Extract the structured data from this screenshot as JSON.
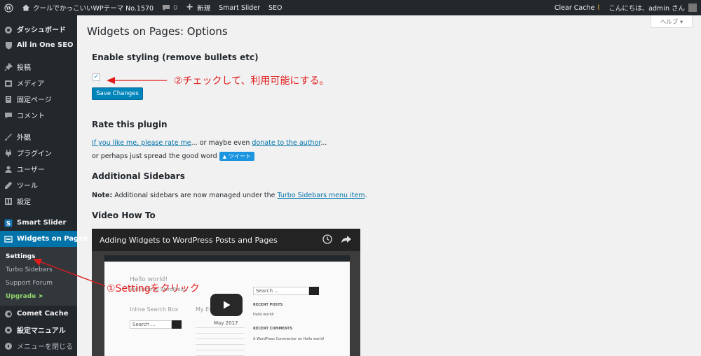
{
  "adminbar": {
    "site_name": "クールでかっこいいWPテーマ No.1570",
    "comments_count": "0",
    "new_label": "新規",
    "smart_slider": "Smart Slider",
    "seo": "SEO",
    "clear_cache": "Clear Cache",
    "greeting": "こんにちは、admin さん"
  },
  "sidebar": {
    "items": [
      {
        "label": "ダッシュボード",
        "icon": "dashboard-icon"
      },
      {
        "label": "All in One SEO",
        "icon": "shield-icon"
      },
      {
        "label": "投稿",
        "icon": "pin-icon"
      },
      {
        "label": "メディア",
        "icon": "media-icon"
      },
      {
        "label": "固定ページ",
        "icon": "page-icon"
      },
      {
        "label": "コメント",
        "icon": "comment-icon"
      },
      {
        "label": "外観",
        "icon": "brush-icon"
      },
      {
        "label": "プラグイン",
        "icon": "plugin-icon"
      },
      {
        "label": "ユーザー",
        "icon": "user-icon"
      },
      {
        "label": "ツール",
        "icon": "wrench-icon"
      },
      {
        "label": "設定",
        "icon": "settings-icon"
      },
      {
        "label": "Smart Slider",
        "icon": "slider-icon"
      },
      {
        "label": "Widgets on Pages",
        "icon": "widgets-icon"
      },
      {
        "label": "Comet Cache",
        "icon": "cache-icon"
      },
      {
        "label": "設定マニュアル",
        "icon": "manual-icon"
      },
      {
        "label": "メニューを閉じる",
        "icon": "collapse-icon"
      }
    ],
    "submenu": [
      "Settings",
      "Turbo Sidebars",
      "Support Forum",
      "Upgrade ➤"
    ]
  },
  "help_label": "ヘルプ ▾",
  "page_title": "Widgets on Pages: Options",
  "styling": {
    "heading": "Enable styling (remove bullets etc)",
    "checked": true,
    "save_label": "Save Changes"
  },
  "rate": {
    "heading": "Rate this plugin",
    "link1": "If you like me, please rate me",
    "text1": "... or maybe even ",
    "link2": "donate to the author",
    "text2": "...",
    "text3": "or perhaps just spread the good word",
    "tweet": "ツイート"
  },
  "sidebars": {
    "heading": "Additional Sidebars",
    "note_label": "Note:",
    "note_text": " Additional sidebars are now managed under the ",
    "note_link": "Turbo Sidebars menu item",
    "note_end": "."
  },
  "video": {
    "heading": "Video How To",
    "title": "Adding Widgets to WordPress Posts and Pages",
    "hello": "Hello world!",
    "welcome": "Welcome to WordPress.",
    "inline_search": "Inline Search Box",
    "my_events": "My Events",
    "may": "May 2017",
    "search1": "Search ...",
    "search2": "Search ...",
    "recent_posts": "RECENT POSTS",
    "recent_comments": "RECENT COMMENTS",
    "rp_item": "Hello world!",
    "rc_item": "A WordPress Commenter on Hello world!"
  },
  "annotations": {
    "step2": "②チェックして、利用可能にする。",
    "step1": "①Settingをクリック"
  },
  "colors": {
    "accent": "#0073aa",
    "annotation": "#e21b1b",
    "sidebar_bg": "#23282d"
  }
}
